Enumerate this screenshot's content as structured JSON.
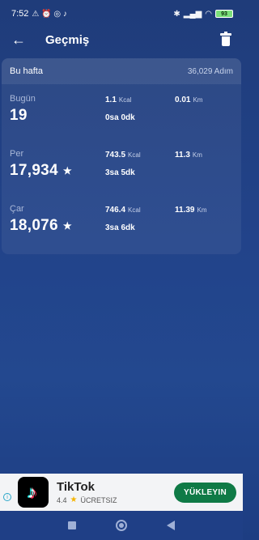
{
  "status": {
    "time": "7:52",
    "battery": "93"
  },
  "header": {
    "title": "Geçmiş"
  },
  "week": {
    "label": "Bu hafta",
    "total": "36,029 Adım"
  },
  "days": [
    {
      "name": "Bugün",
      "steps": "19",
      "star": "",
      "kcal": "1.1",
      "kcal_unit": "Kcal",
      "km": "0.01",
      "km_unit": "Km",
      "duration": "0sa 0dk"
    },
    {
      "name": "Per",
      "steps": "17,934",
      "star": "★",
      "kcal": "743.5",
      "kcal_unit": "Kcal",
      "km": "11.3",
      "km_unit": "Km",
      "duration": "3sa 5dk"
    },
    {
      "name": "Çar",
      "steps": "18,076",
      "star": "★",
      "kcal": "746.4",
      "kcal_unit": "Kcal",
      "km": "11.39",
      "km_unit": "Km",
      "duration": "3sa 6dk"
    }
  ],
  "ad": {
    "app_name": "TikTok",
    "rating": "4.4",
    "price": "ÜCRETSIZ",
    "install_label": "YÜKLEYIN"
  },
  "colors": {
    "background": "#22438a",
    "install_button": "#0f7a46"
  }
}
